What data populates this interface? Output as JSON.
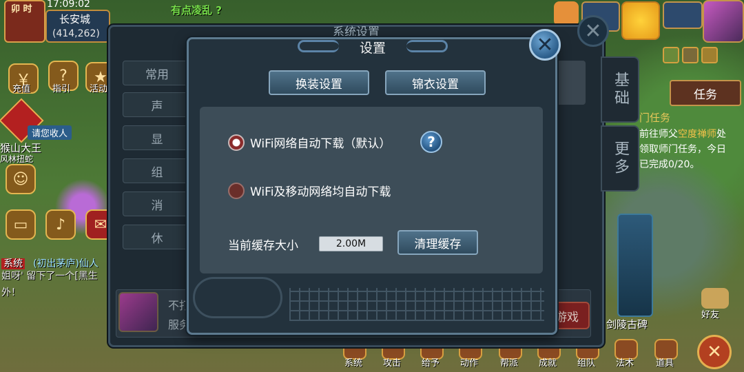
{
  "status_bar": {
    "clock": "卯 时",
    "time": "17:09:02"
  },
  "location": {
    "name": "长安城",
    "coords": "(414,262)"
  },
  "world_chat_snippet": "有点凌乱 ?",
  "left_menu": [
    {
      "label": "充值"
    },
    {
      "label": "指引"
    },
    {
      "label": "活动"
    }
  ],
  "recruit_tag": "请您收人",
  "left_names": [
    "猴山大王",
    "风林扭蛇"
  ],
  "left_chat": {
    "channel": "系统",
    "line1": "(初出茅庐)仙人",
    "line2": "姐呀' 留下了一个[黑生",
    "line3": "外！"
  },
  "right_panel": {
    "task_tab": "任务",
    "task_title": "门任务",
    "task_line1_prefix": "前往师父",
    "task_line1_highlight": "空度禅师",
    "task_line1_suffix": "处",
    "task_line2": "领取师门任务，今日",
    "task_line3": "已完成0/20。",
    "landmark": "剑陵古碑",
    "friends": "好友"
  },
  "bottom_bar": [
    "系统",
    "攻击",
    "给予",
    "动作",
    "帮派",
    "成就",
    "组队",
    "法术",
    "道具"
  ],
  "back_window": {
    "title": "系统设置",
    "nav": [
      "常用",
      "声",
      "显",
      "组",
      "消",
      "休"
    ],
    "side_tabs": [
      "基础",
      "更多"
    ],
    "footer_line1": "不打",
    "footer_line2": "服务",
    "footer_button": "游戏"
  },
  "dialog": {
    "title": "设置",
    "tab_costume": "换装设置",
    "tab_brocade": "锦衣设置",
    "option_wifi": "WiFi网络自动下载（默认）",
    "option_wifi_mobile": "WiFi及移动网络均自动下载",
    "selected_option": "option_wifi",
    "help": "?",
    "cache_label": "当前缓存大小",
    "cache_value": "2.00M",
    "clear_cache": "清理缓存",
    "close": "✕"
  },
  "colors": {
    "dialog_bg": "#23323d",
    "dialog_border": "#5d7a8f",
    "button_bg": "#3d5b70",
    "accent_blue": "#4f8fc4",
    "radio_selected": "#8a2b2b",
    "highlight_gold": "#f2c14a"
  }
}
